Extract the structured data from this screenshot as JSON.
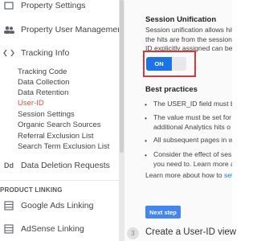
{
  "sidebar": {
    "property_settings": "Property Settings",
    "property_user_management": "Property User Management",
    "tracking_info": "Tracking Info",
    "tracking_items": [
      "Tracking Code",
      "Data Collection",
      "Data Retention",
      "User-ID",
      "Session Settings",
      "Organic Search Sources",
      "Referral Exclusion List",
      "Search Term Exclusion List"
    ],
    "active_item": "User-ID",
    "data_deletion_requests": "Data Deletion Requests",
    "product_linking_label": "PRODUCT LINKING",
    "google_ads_linking": "Google Ads Linking",
    "adsense_linking": "AdSense Linking",
    "dd_icon_text": "Dd"
  },
  "main": {
    "session_unification_title": "Session Unification",
    "session_text": [
      "Session unification allows hits",
      "the hits are from the session i",
      "ID explicitly assigned can be a"
    ],
    "toggle_label": "ON",
    "best_practices_title": "Best practices",
    "bullets": [
      [
        "The USER_ID field must be"
      ],
      [
        "The value must be set for",
        "additional Analytics hits o"
      ],
      [
        "All subsequent pages in w"
      ],
      [
        "Consider the effect of ses",
        "you need to. Learn more ab"
      ]
    ],
    "learn_more_prefix": "Learn more about how to ",
    "learn_more_link": "set",
    "next_step_label": "Next step",
    "step_number": "3",
    "step_title": "Create a User-ID view"
  },
  "colors": {
    "accent": "#1a73e8",
    "highlight": "#d33b3b",
    "active": "#d9534f"
  }
}
